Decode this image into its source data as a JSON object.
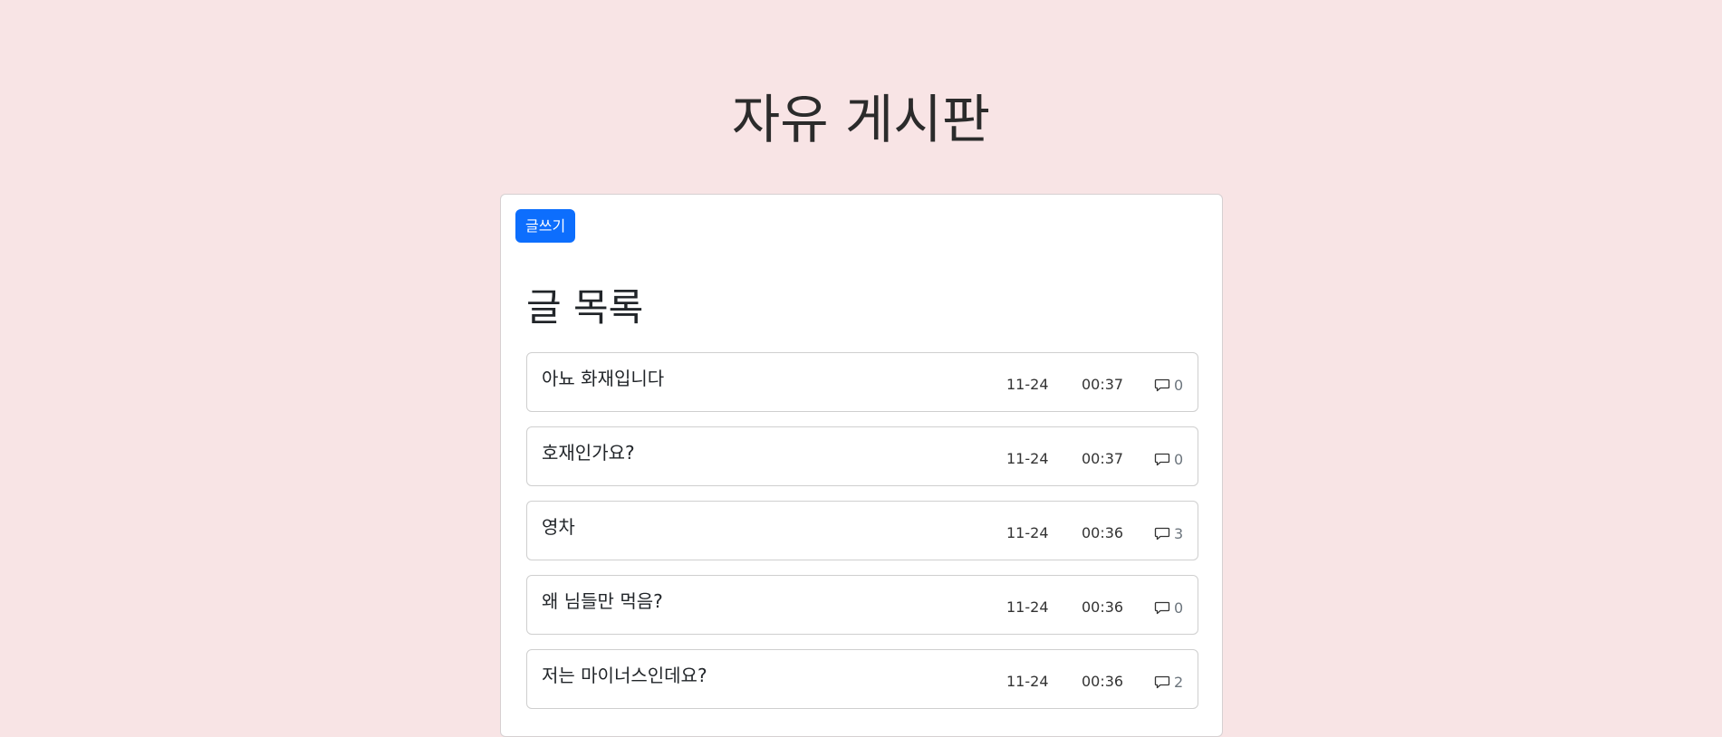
{
  "header": {
    "title": "자유 게시판"
  },
  "toolbar": {
    "write_label": "글쓰기"
  },
  "list": {
    "title": "글 목록",
    "posts": [
      {
        "title": "아뇨 화재입니다",
        "date": "11-24",
        "time": "00:37",
        "comments": "0"
      },
      {
        "title": "호재인가요?",
        "date": "11-24",
        "time": "00:37",
        "comments": "0"
      },
      {
        "title": "영차",
        "date": "11-24",
        "time": "00:36",
        "comments": "3"
      },
      {
        "title": "왜 님들만 먹음?",
        "date": "11-24",
        "time": "00:36",
        "comments": "0"
      },
      {
        "title": "저는 마이너스인데요?",
        "date": "11-24",
        "time": "00:36",
        "comments": "2"
      }
    ]
  },
  "icons": {
    "comment": "comment-icon"
  },
  "colors": {
    "background": "#f8e4e5",
    "accent": "#0d6efd"
  }
}
